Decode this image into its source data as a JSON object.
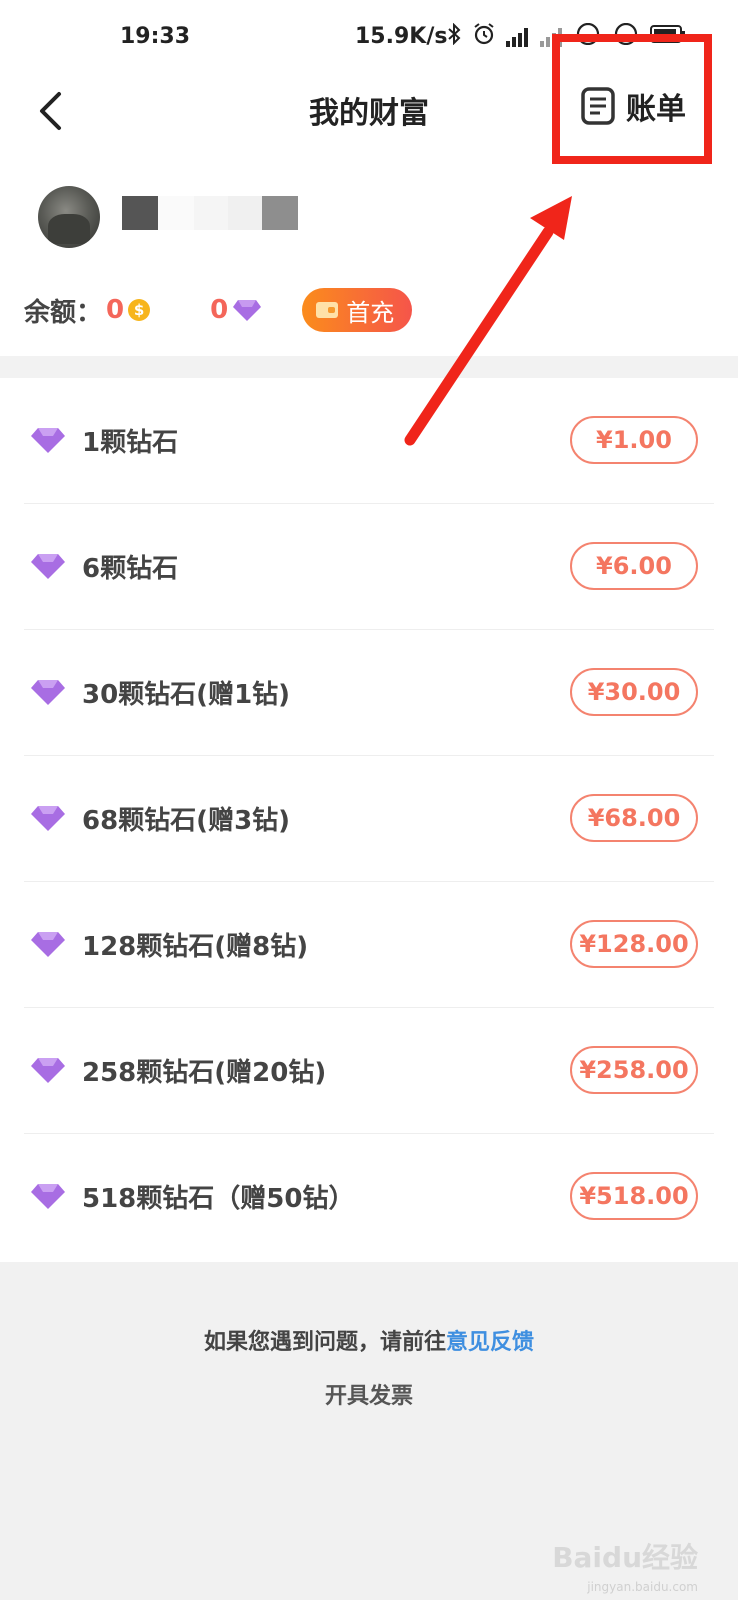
{
  "status_bar": {
    "time": "19:33",
    "network_speed": "15.9K/s",
    "icons": [
      "bluetooth-icon",
      "alarm-icon",
      "signal-icon",
      "wifi-icon",
      "battery-icon"
    ]
  },
  "header": {
    "title": "我的财富",
    "bill_label": "账单",
    "back_icon": "chevron-left-icon",
    "bill_icon": "document-icon"
  },
  "profile": {
    "balance_label": "余额：",
    "coin_balance": "0",
    "coin_symbol": "$",
    "diamond_balance": "0",
    "first_charge_label": "首充"
  },
  "packages": [
    {
      "name": "1颗钻石",
      "price": "¥1.00"
    },
    {
      "name": "6颗钻石",
      "price": "¥6.00"
    },
    {
      "name": "30颗钻石(赠1钻)",
      "price": "¥30.00"
    },
    {
      "name": "68颗钻石(赠3钻)",
      "price": "¥68.00"
    },
    {
      "name": "128颗钻石(赠8钻)",
      "price": "¥128.00"
    },
    {
      "name": "258颗钻石(赠20钻)",
      "price": "¥258.00"
    },
    {
      "name": "518颗钻石（赠50钻）",
      "price": "¥518.00"
    }
  ],
  "footer": {
    "help_text": "如果您遇到问题，请前往",
    "feedback_link": "意见反馈",
    "invoice_label": "开具发票"
  },
  "watermark": {
    "text": "Baidu经验",
    "sub": "jingyan.baidu.com"
  },
  "colors": {
    "accent": "#f47660",
    "gem": "#a66ae0",
    "link": "#3f8fe0",
    "annotation": "#f0251a"
  }
}
